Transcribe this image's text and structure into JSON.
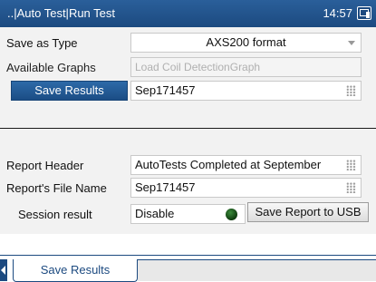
{
  "titlebar": {
    "title": "..|Auto Test|Run Test",
    "time": "14:57",
    "icon": "screen-capture-icon"
  },
  "form": {
    "save_as_type": {
      "label": "Save as Type",
      "value": "AXS200 format"
    },
    "available_graphs": {
      "label": "Available Graphs",
      "value": "Load Coil DetectionGraph"
    },
    "save_results": {
      "button_label": "Save Results",
      "value": "Sep171457"
    },
    "report_header": {
      "label": "Report Header",
      "value": "AutoTests Completed at September"
    },
    "report_file_name": {
      "label": "Report's File Name",
      "value": "Sep171457"
    },
    "session_result": {
      "label": "Session result",
      "value": "Disable",
      "button_label": "Save Report to USB"
    }
  },
  "tabs": [
    {
      "label": "Save Results"
    }
  ],
  "colors": {
    "accent": "#1c4a80",
    "led": "#0d3a0d"
  }
}
